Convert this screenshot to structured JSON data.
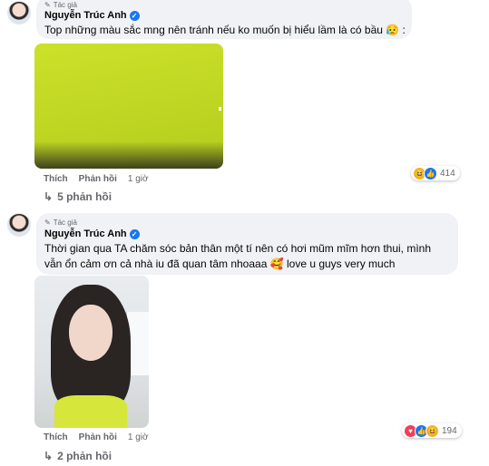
{
  "comments": [
    {
      "author_tag": "Tác giả",
      "author": "Nguyễn Trúc Anh",
      "text": "Top những màu sắc mng nên tránh nếu ko muốn bị hiểu lầm là có bầu 😥 :",
      "photo": "green fabric",
      "actions": {
        "like": "Thích",
        "reply": "Phản hồi",
        "time": "1 giờ"
      },
      "reactions": {
        "icons": [
          "haha",
          "like"
        ],
        "count": "414"
      },
      "replies_label": "5 phản hồi"
    },
    {
      "author_tag": "Tác giả",
      "author": "Nguyễn Trúc Anh",
      "text_line1": "Thời gian qua TA chăm sóc bản thân một tí nên có hơi mũm mĩm hơn thui, mình",
      "text_line2": "vẫn ổn cảm ơn cả nhà iu đã quan tâm nhoaaa 🥰 love u guys very much",
      "photo": "selfie",
      "actions": {
        "like": "Thích",
        "reply": "Phản hồi",
        "time": "1 giờ"
      },
      "reactions": {
        "icons": [
          "love",
          "like",
          "haha"
        ],
        "count": "194"
      },
      "replies_label": "2 phản hồi"
    }
  ],
  "icons": {
    "pencil": "✎",
    "verified": "✓",
    "reply_arrow": "↳",
    "haha": "😆",
    "like": "👍",
    "love": "♥"
  }
}
